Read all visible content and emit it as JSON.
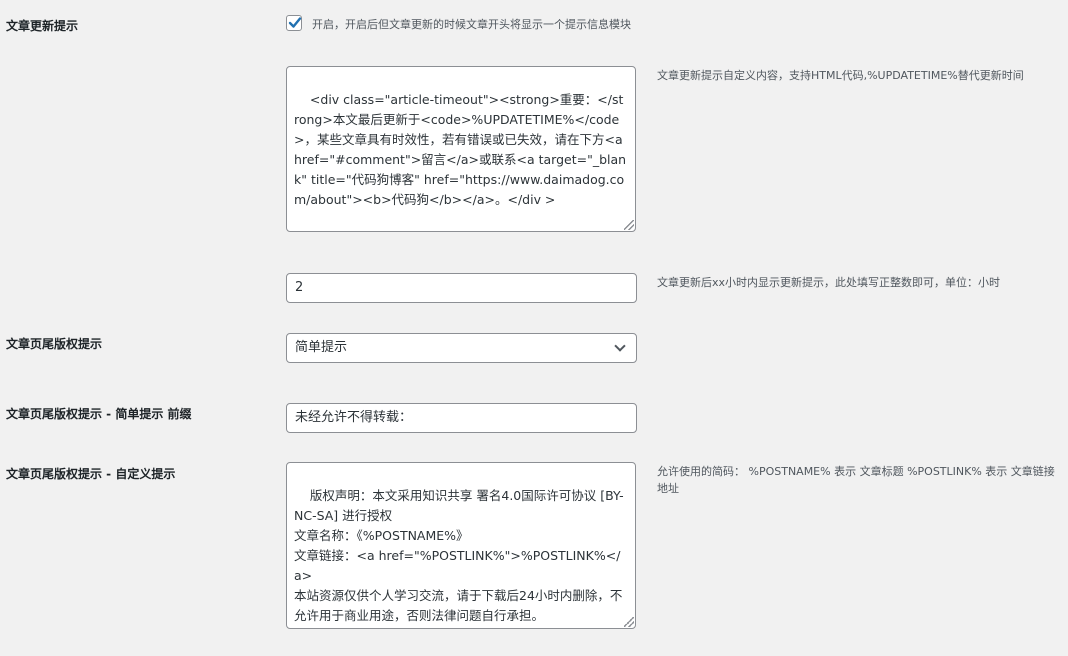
{
  "colors": {
    "accent": "#2271b1",
    "text": "#1d2327",
    "muted": "#50575e",
    "border": "#8c8f94",
    "background": "#f1f1f1"
  },
  "article_update_notice": {
    "label": "文章更新提示",
    "enable_checked": true,
    "enable_text": "开启，开启后但文章更新的时候文章开头将显示一个提示信息模块",
    "content_value": "<div class=\"article-timeout\"><strong>重要：</strong>本文最后更新于<code>%UPDATETIME%</code>，某些文章具有时效性，若有错误或已失效，请在下方<a href=\"#comment\">留言</a>或联系<a target=\"_blank\" title=\"代码狗博客\" href=\"https://www.daimadog.com/about\"><b>代码狗</b></a>。</div >",
    "content_desc": "文章更新提示自定义内容，支持HTML代码,%UPDATETIME%替代更新时间",
    "hours_value": "2",
    "hours_desc": "文章更新后xx小时内显示更新提示，此处填写正整数即可，单位：小时"
  },
  "footer_copyright": {
    "label": "文章页尾版权提示",
    "selected": "简单提示",
    "simple_prefix_label": "文章页尾版权提示 - 简单提示 前缀",
    "simple_prefix_value": "未经允许不得转载：",
    "custom_label": "文章页尾版权提示 - 自定义提示",
    "custom_value": "版权声明：本文采用知识共享 署名4.0国际许可协议 [BY-NC-SA] 进行授权\n文章名称：《%POSTNAME%》\n文章链接：<a href=\"%POSTLINK%\">%POSTLINK%</a>\n本站资源仅供个人学习交流，请于下载后24小时内删除，不允许用于商业用途，否则法律问题自行承担。",
    "custom_desc": "允许使用的简码： %POSTNAME% 表示 文章标题 %POSTLINK% 表示 文章链接地址"
  }
}
